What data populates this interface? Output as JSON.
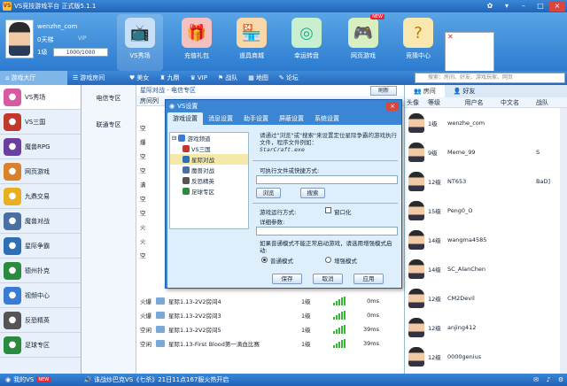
{
  "app": {
    "title": "VS竞技游戏平台 正式版5.1.1",
    "logo_text": "VS"
  },
  "user": {
    "name": "wenzhe_com",
    "money": "0天梯",
    "vip": "VIP",
    "level": "1级",
    "exp": "1000/1000"
  },
  "nav": [
    {
      "label": "VS秀场",
      "icon": "tv-icon"
    },
    {
      "label": "充值礼包",
      "icon": "gift-icon"
    },
    {
      "label": "道具商城",
      "icon": "shop-icon"
    },
    {
      "label": "幸运转盘",
      "icon": "wheel-icon"
    },
    {
      "label": "网页游戏",
      "icon": "gamepad-icon",
      "badge": "NEW"
    },
    {
      "label": "竞猜中心",
      "icon": "question-icon"
    }
  ],
  "menubar": {
    "items": [
      "游戏大厅",
      "游戏房间",
      "美女",
      "九鼎",
      "VIP",
      "战队",
      "地图",
      "论坛"
    ],
    "search_placeholder": "搜索：房间、好友、游戏玩家、网页"
  },
  "sidebar": [
    {
      "label": "VS秀场",
      "color": "#d85aa0"
    },
    {
      "label": "VS三国",
      "color": "#c0392b"
    },
    {
      "label": "魔兽RPG",
      "color": "#6a3fa0"
    },
    {
      "label": "网页游戏",
      "color": "#d9822b"
    },
    {
      "label": "九鼎交易",
      "color": "#e8b020"
    },
    {
      "label": "魔兽对战",
      "color": "#4a6fa5"
    },
    {
      "label": "星际争霸",
      "color": "#2f6fb3"
    },
    {
      "label": "德州扑克",
      "color": "#2b8a3e"
    },
    {
      "label": "视频中心",
      "color": "#3a7bd5"
    },
    {
      "label": "反恐精英",
      "color": "#555555"
    },
    {
      "label": "足球专区",
      "color": "#2b8a3e"
    }
  ],
  "zones": [
    "电信专区",
    "联通专区"
  ],
  "main": {
    "breadcrumb": "星际对战 - 电信专区",
    "refresh": "刷新",
    "room_header": "房间列",
    "rows": [
      {
        "status": "火爆",
        "name": "星际1.13-2V2房间4",
        "level": "1级",
        "ms": "0ms"
      },
      {
        "status": "火爆",
        "name": "星际1.13-2V2房间3",
        "level": "1级",
        "ms": "0ms"
      },
      {
        "status": "空闲",
        "name": "星际1.13-2V2房间5",
        "level": "1级",
        "ms": "39ms"
      },
      {
        "status": "空闲",
        "name": "星际1.13-First Blood第一滴血比赛",
        "level": "1级",
        "ms": "39ms"
      }
    ],
    "partial_status": [
      "空",
      "爆",
      "空",
      "空",
      "满",
      "空",
      "空",
      "火",
      "火",
      "空"
    ]
  },
  "right": {
    "tabs": [
      "房间",
      "好友"
    ],
    "headers": [
      "头像",
      "等级",
      "用户名",
      "中文名",
      "战队"
    ],
    "players": [
      {
        "level": "1级",
        "user": "wenzhe_com",
        "cn": "",
        "team": ""
      },
      {
        "level": "9级",
        "user": "Meme_99",
        "cn": "",
        "team": "S"
      },
      {
        "level": "12级",
        "user": "NT653",
        "cn": "",
        "team": "BaD]"
      },
      {
        "level": "15级",
        "user": "Peng0_O",
        "cn": "",
        "team": ""
      },
      {
        "level": "14级",
        "user": "wangma4585",
        "cn": "",
        "team": ""
      },
      {
        "level": "14级",
        "user": "SC_AlanChen",
        "cn": "",
        "team": ""
      },
      {
        "level": "12级",
        "user": "CM2Devil",
        "cn": "",
        "team": ""
      },
      {
        "level": "12级",
        "user": "anjing412",
        "cn": "",
        "team": ""
      },
      {
        "level": "12级",
        "user": "0000genius",
        "cn": "",
        "team": ""
      }
    ]
  },
  "bottom": {
    "my": "我的VS",
    "badge": "NEW",
    "news": "诛战炒巴克VS《七杀》21日11点167服火热开启"
  },
  "dialog": {
    "title": "VS设置",
    "close": "×",
    "tabs": [
      "游戏设置",
      "消息设置",
      "助手设置",
      "屏蔽设置",
      "系统设置"
    ],
    "tree_root": "游戏频道",
    "tree": [
      "VS三国",
      "星际对战",
      "魔兽对战",
      "反恐精英",
      "足球专区"
    ],
    "desc": "请通过\"浏览\"或\"搜索\"来设置定位星际争霸的游戏执行文件，程序文件例如：",
    "example": "StarCraft.exe",
    "path_label": "可执行文件或快捷方式:",
    "path_value": "",
    "browse": "浏览",
    "search": "搜索",
    "mode_label": "游戏运行方式:",
    "windowed": "窗口化",
    "params_label": "详细参数:",
    "params_value": "",
    "hint": "如果普通模式不能正常启动游戏，请选用增强模式启动:",
    "normal_mode": "普通模式",
    "enhanced_mode": "增强模式",
    "ok": "保存",
    "cancel": "取消",
    "apply": "应用"
  }
}
